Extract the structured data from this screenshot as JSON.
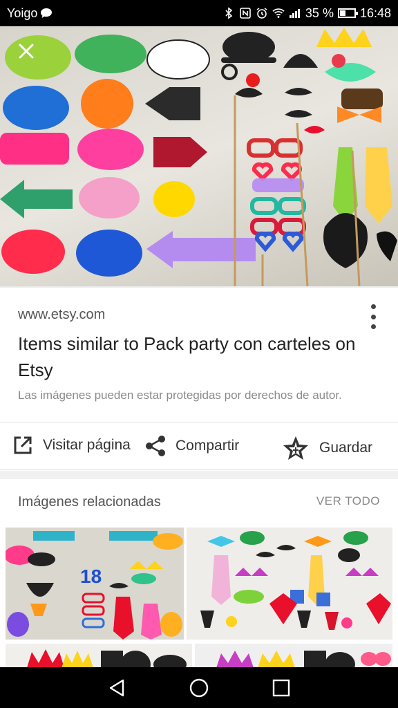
{
  "status": {
    "carrier": "Yoigo",
    "battery": "35 %",
    "battery_level": 0.35,
    "time": "16:48"
  },
  "hero": {
    "alt": "Party props photo"
  },
  "result": {
    "domain": "www.etsy.com",
    "title": "Items similar to Pack party con carteles on Etsy",
    "copyright": "Las imágenes pueden estar protegidas por derechos de autor."
  },
  "actions": {
    "visit": "Visitar página",
    "share": "Compartir",
    "save": "Guardar"
  },
  "related": {
    "title": "Imágenes relacionadas",
    "see_all": "VER TODO"
  },
  "colors": {
    "accent": "#ffffff",
    "text": "#222222",
    "muted": "#8a8a8a"
  }
}
